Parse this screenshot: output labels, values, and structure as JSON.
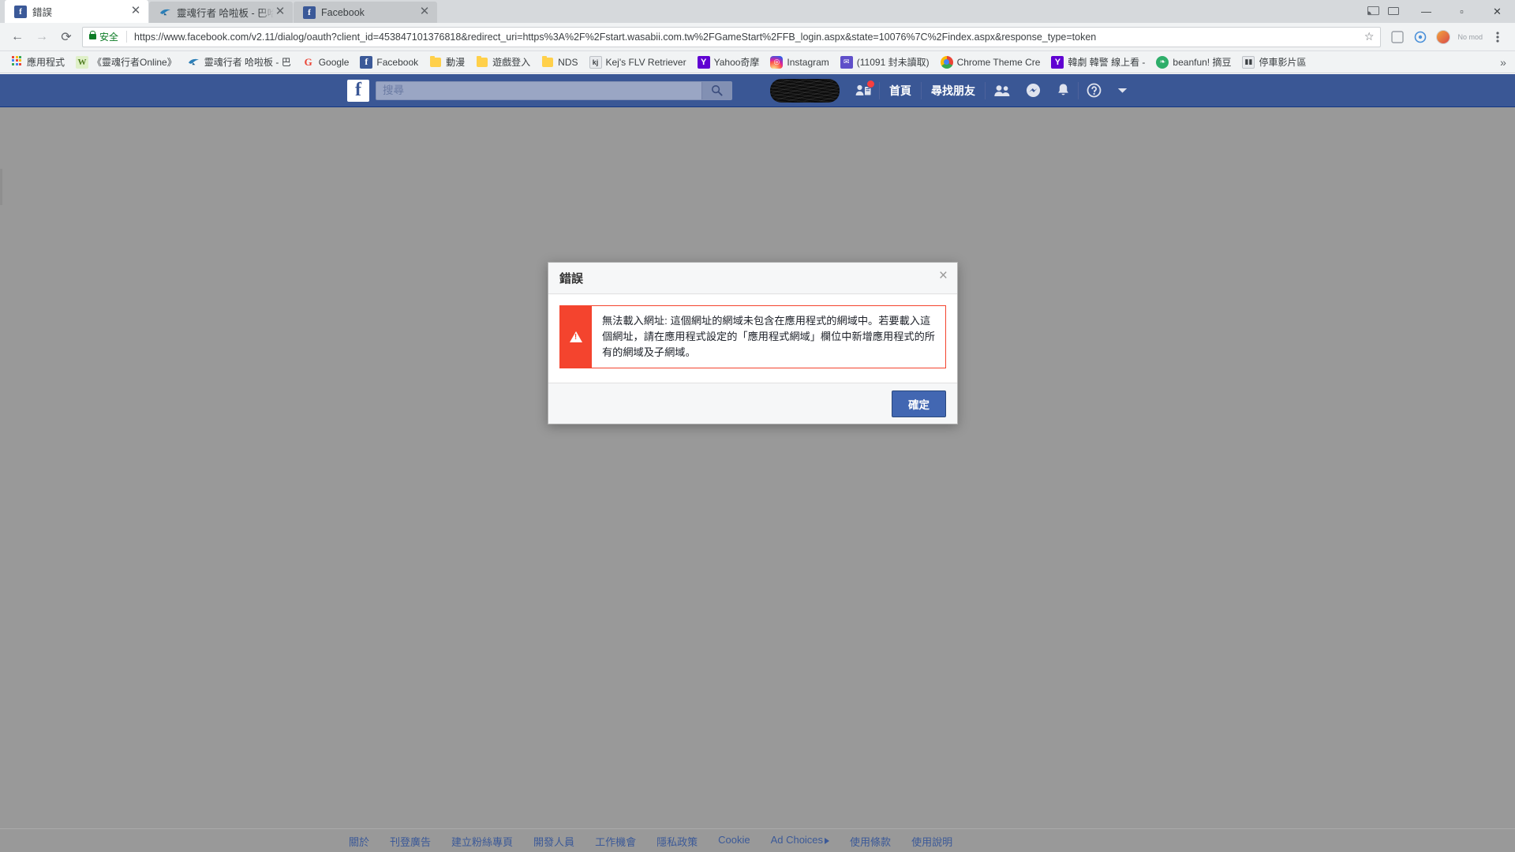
{
  "browser": {
    "tabs": [
      {
        "title": "錯誤",
        "favicon": "facebook-icon",
        "active": true
      },
      {
        "title": "靈魂行者 哈啦板 - 巴哈姆",
        "favicon": "baha-dragon-icon",
        "active": false
      },
      {
        "title": "Facebook",
        "favicon": "facebook-icon",
        "active": false
      }
    ],
    "window_controls": {
      "minimize": "—",
      "maximize": "▫",
      "close": "✕"
    },
    "nav": {
      "back": "←",
      "forward": "→",
      "reload": "⟳"
    },
    "omnibox": {
      "secure_label": "安全",
      "url": "https://www.facebook.com/v2.11/dialog/oauth?client_id=453847101376818&redirect_uri=https%3A%2F%2Fstart.wasabii.com.tw%2FGameStart%2FFB_login.aspx&state=10076%7C%2Findex.aspx&response_type=token",
      "star": "☆"
    },
    "profile_label": "No mod",
    "bookmarks": [
      {
        "label": "應用程式",
        "icon": "apps-grid-icon"
      },
      {
        "label": "《靈魂行者Online》",
        "icon": "w-icon"
      },
      {
        "label": "靈魂行者 哈啦板 - 巴",
        "icon": "baha-dragon-icon"
      },
      {
        "label": "Google",
        "icon": "google-icon"
      },
      {
        "label": "Facebook",
        "icon": "facebook-icon"
      },
      {
        "label": "動漫",
        "icon": "folder-icon"
      },
      {
        "label": "遊戲登入",
        "icon": "folder-icon"
      },
      {
        "label": "NDS",
        "icon": "folder-icon"
      },
      {
        "label": "Kej's FLV Retriever",
        "icon": "kej-icon"
      },
      {
        "label": "Yahoo奇摩",
        "icon": "yahoo-icon"
      },
      {
        "label": "Instagram",
        "icon": "instagram-icon"
      },
      {
        "label": "(11091 封未讀取)",
        "icon": "mail-icon"
      },
      {
        "label": "Chrome Theme Cre",
        "icon": "chrome-icon"
      },
      {
        "label": "韓劇 韓警 線上看 -",
        "icon": "yahoo-icon"
      },
      {
        "label": "beanfun! 摘豆",
        "icon": "leaf-icon"
      },
      {
        "label": "停車影片區",
        "icon": "hulu-icon"
      }
    ],
    "bookmark_overflow": "»"
  },
  "facebook": {
    "logo": "f",
    "search": {
      "placeholder": "搜尋",
      "value": "",
      "button_icon": "search-icon"
    },
    "nav": {
      "profile_name_redacted": "",
      "friend_requests_icon": "friend-request-icon",
      "home": "首頁",
      "find_friends": "尋找朋友",
      "friends_icon": "friends-icon",
      "messenger_icon": "messenger-icon",
      "notifications_icon": "bell-icon",
      "help_icon": "help-icon",
      "account_menu_icon": "chevron-down-icon"
    },
    "footer_links": [
      "關於",
      "刊登廣告",
      "建立粉絲專頁",
      "開發人員",
      "工作機會",
      "隱私政策",
      "Cookie",
      "Ad Choices",
      "使用條款",
      "使用說明"
    ]
  },
  "dialog": {
    "title": "錯誤",
    "close_label": "×",
    "error_text": "無法載入網址: 這個網址的網域未包含在應用程式的網域中。若要載入這個網址，請在應用程式設定的「應用程式網域」欄位中新增應用程式的所有的網域及子網域。",
    "ok_button": "確定"
  },
  "colors": {
    "fb_blue": "#3a5795",
    "fb_button_blue": "#4267b2",
    "error_red": "#f4442e",
    "page_gray": "#999999",
    "link_blue": "#3b5998"
  }
}
